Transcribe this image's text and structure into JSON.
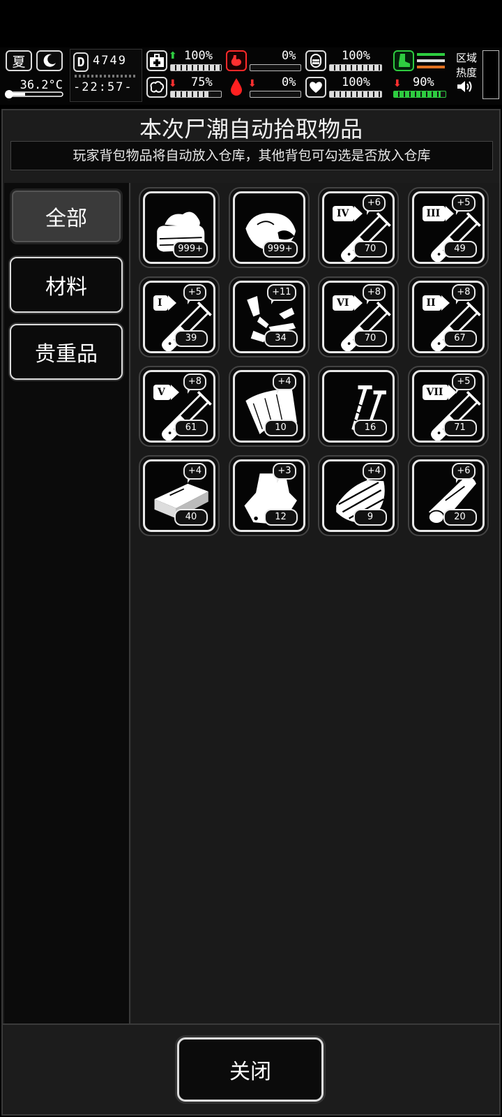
{
  "hud": {
    "season": "夏",
    "temperature": "36.2°C",
    "day_label": "D",
    "day": "4749",
    "clock": "-22:57-",
    "stats": [
      {
        "id": "health",
        "value": "100%",
        "trend": "up",
        "fill": 1.0
      },
      {
        "id": "hunger",
        "value": "0%",
        "trend": "none",
        "fill": 0.0
      },
      {
        "id": "armor",
        "value": "100%",
        "trend": "none",
        "fill": 1.0
      },
      {
        "id": "brain",
        "value": "75%",
        "trend": "down",
        "fill": 0.75
      },
      {
        "id": "blood",
        "value": "0%",
        "trend": "down",
        "fill": 0.0
      },
      {
        "id": "heart",
        "value": "100%",
        "trend": "none",
        "fill": 1.0
      }
    ],
    "stamina": {
      "value": "90%",
      "trend": "down",
      "fill": 0.9
    },
    "region_heat_label_1": "区域",
    "region_heat_label_2": "热度"
  },
  "dialog": {
    "title": "本次尸潮自动拾取物品",
    "subtitle": "玩家背包物品将自动放入仓库，其他背包可勾选是否放入仓库",
    "tabs": [
      {
        "label": "全部",
        "active": true
      },
      {
        "label": "材料",
        "active": false
      },
      {
        "label": "贵重品",
        "active": false
      }
    ],
    "close_label": "关闭"
  },
  "items": [
    {
      "icon": "cloth-icon",
      "count": "999+",
      "plus": "",
      "numeral": ""
    },
    {
      "icon": "meat-icon",
      "count": "999+",
      "plus": "",
      "numeral": ""
    },
    {
      "icon": "test-tube-iv-icon",
      "count": "70",
      "plus": "+6",
      "numeral": "IV"
    },
    {
      "icon": "test-tube-iii-icon",
      "count": "49",
      "plus": "+5",
      "numeral": "III"
    },
    {
      "icon": "test-tube-i-icon",
      "count": "39",
      "plus": "+5",
      "numeral": "I"
    },
    {
      "icon": "scrap-metal-icon",
      "count": "34",
      "plus": "+11",
      "numeral": ""
    },
    {
      "icon": "test-tube-vi-icon",
      "count": "70",
      "plus": "+8",
      "numeral": "VI"
    },
    {
      "icon": "test-tube-ii-icon",
      "count": "67",
      "plus": "+8",
      "numeral": "II"
    },
    {
      "icon": "test-tube-v-icon",
      "count": "61",
      "plus": "+8",
      "numeral": "V"
    },
    {
      "icon": "sheet-metal-icon",
      "count": "10",
      "plus": "+4",
      "numeral": ""
    },
    {
      "icon": "screws-icon",
      "count": "16",
      "plus": "",
      "numeral": ""
    },
    {
      "icon": "test-tube-vii-icon",
      "count": "71",
      "plus": "+5",
      "numeral": "VII"
    },
    {
      "icon": "wood-plank-icon",
      "count": "40",
      "plus": "+4",
      "numeral": ""
    },
    {
      "icon": "leather-icon",
      "count": "12",
      "plus": "+3",
      "numeral": ""
    },
    {
      "icon": "broken-wood-icon",
      "count": "9",
      "plus": "+4",
      "numeral": ""
    },
    {
      "icon": "wood-log-icon",
      "count": "20",
      "plus": "+6",
      "numeral": ""
    }
  ]
}
